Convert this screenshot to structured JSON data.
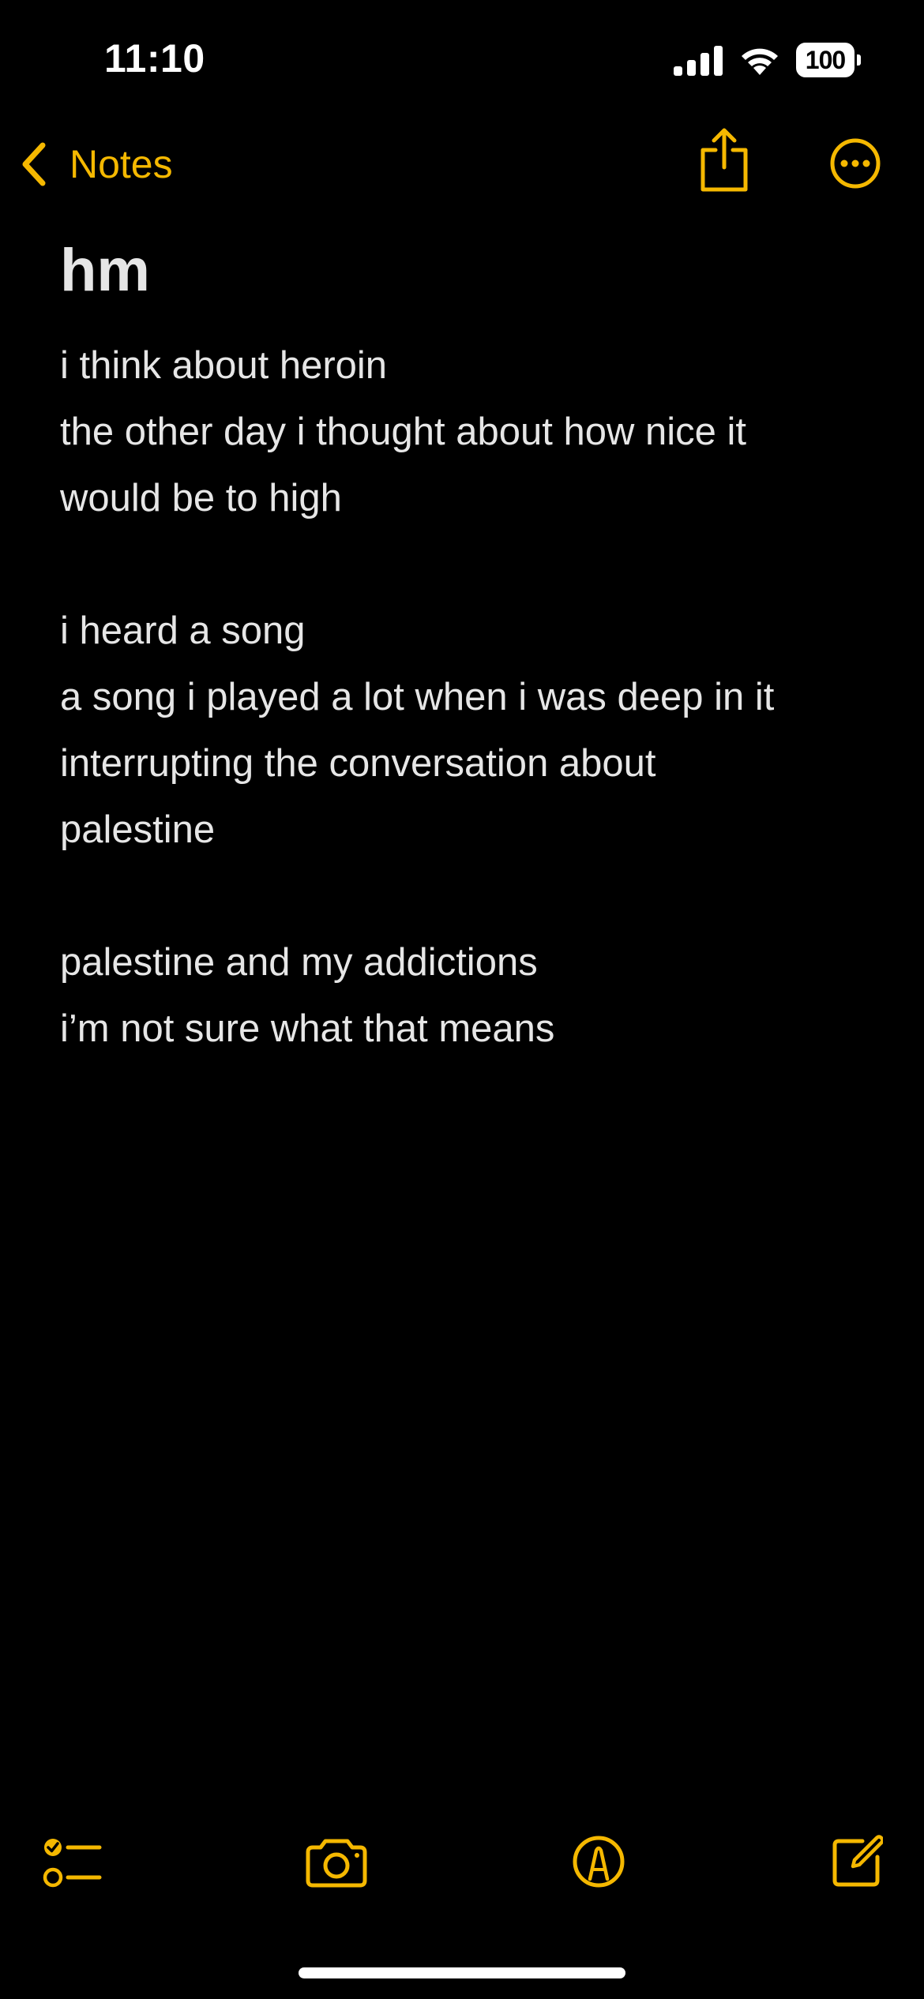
{
  "status_bar": {
    "time": "11:10",
    "battery_level": "100",
    "icons": [
      "signal-icon",
      "wifi-icon",
      "battery-icon"
    ]
  },
  "nav": {
    "back_label": "Notes",
    "back_icon": "chevron-left-icon",
    "share_icon": "share-icon",
    "more_icon": "ellipsis-circle-icon"
  },
  "note": {
    "title": "hm",
    "lines": [
      "i think about heroin",
      "the other day i thought about how nice it",
      "would be to high",
      "",
      "i heard a song",
      "a song i played a lot when i was deep in it",
      "interrupting the conversation about",
      "palestine",
      "",
      "palestine and my addictions",
      "i’m not sure what that means"
    ]
  },
  "toolbar": {
    "icons": [
      "checklist-icon",
      "camera-icon",
      "markup-icon",
      "compose-icon"
    ]
  },
  "colors": {
    "background": "#000000",
    "accent": "#f5b800",
    "text": "#e6e6e6"
  }
}
